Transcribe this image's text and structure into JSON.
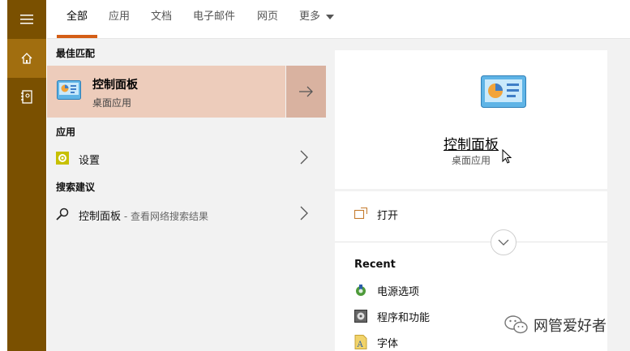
{
  "rail": {
    "menu_icon": "hamburger-icon",
    "home_icon": "home-icon",
    "notebook_icon": "notebook-icon"
  },
  "tabs": [
    {
      "label": "全部",
      "active": true
    },
    {
      "label": "应用",
      "active": false
    },
    {
      "label": "文档",
      "active": false
    },
    {
      "label": "电子邮件",
      "active": false
    },
    {
      "label": "网页",
      "active": false
    },
    {
      "label": "更多",
      "active": false
    }
  ],
  "results": {
    "best_match_heading": "最佳匹配",
    "best_match": {
      "title": "控制面板",
      "subtitle": "桌面应用"
    },
    "apps_heading": "应用",
    "apps": [
      {
        "label": "设置"
      }
    ],
    "suggestions_heading": "搜索建议",
    "suggestions": [
      {
        "label": "控制面板",
        "suffix": " - 查看网络搜索结果"
      }
    ]
  },
  "detail": {
    "title": "控制面板",
    "subtitle": "桌面应用",
    "open_label": "打开",
    "recent_heading": "Recent",
    "recent": [
      {
        "label": "电源选项",
        "icon": "power-options-icon"
      },
      {
        "label": "程序和功能",
        "icon": "programs-features-icon"
      },
      {
        "label": "字体",
        "icon": "fonts-icon"
      }
    ]
  },
  "watermark": {
    "text": "网管爱好者"
  },
  "colors": {
    "rail": "#7a5000",
    "rail_active": "#a16e0f",
    "accent": "#d45e16",
    "best_match_bg": "#edccbb",
    "best_match_arrow_bg": "#d9b2a0"
  }
}
